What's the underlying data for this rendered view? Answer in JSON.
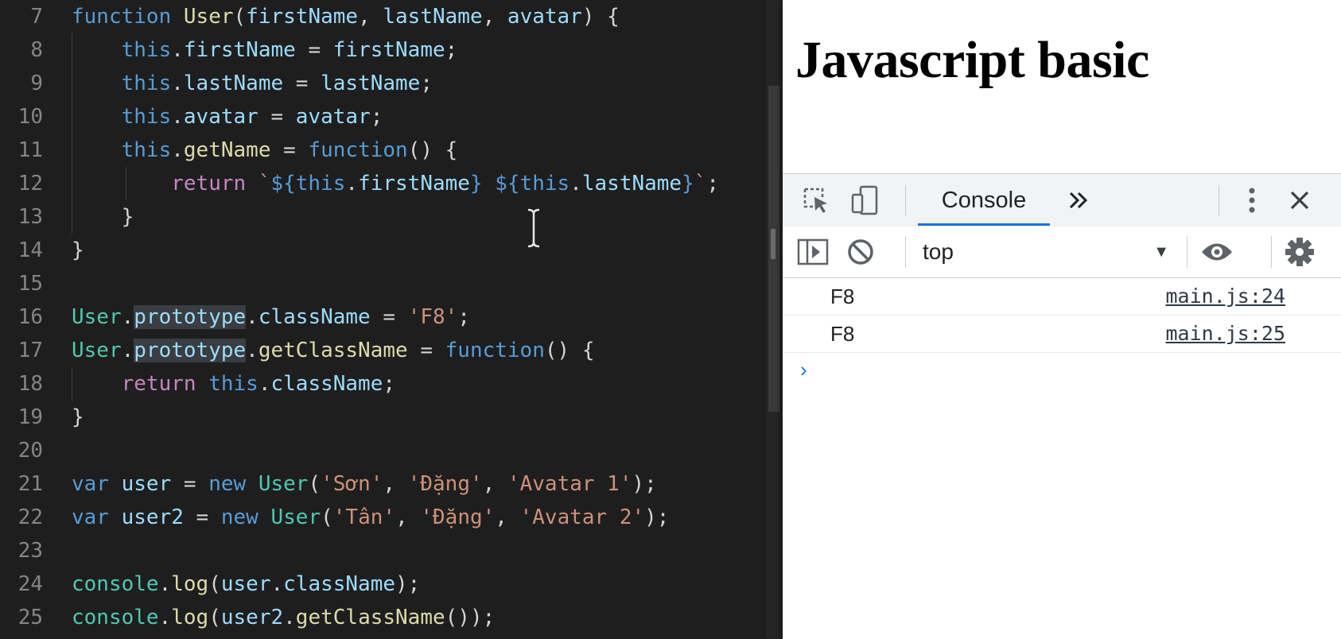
{
  "editor": {
    "lines": [
      {
        "num": "7",
        "tokens": [
          [
            "k-fn",
            "function"
          ],
          [
            "",
            ""
          ],
          [
            "t-fun",
            " User"
          ],
          [
            "",
            "("
          ],
          [
            "t-var",
            "firstName"
          ],
          [
            "",
            ", "
          ],
          [
            "t-var",
            "lastName"
          ],
          [
            "",
            ", "
          ],
          [
            "t-var",
            "avatar"
          ],
          [
            "",
            ") {"
          ]
        ]
      },
      {
        "num": "8",
        "tokens": [
          [
            "",
            "    "
          ],
          [
            "k-fn",
            "this"
          ],
          [
            "",
            "."
          ],
          [
            "t-var",
            "firstName"
          ],
          [
            "",
            " = "
          ],
          [
            "t-var",
            "firstName"
          ],
          [
            "",
            ";"
          ]
        ]
      },
      {
        "num": "9",
        "tokens": [
          [
            "",
            "    "
          ],
          [
            "k-fn",
            "this"
          ],
          [
            "",
            "."
          ],
          [
            "t-var",
            "lastName"
          ],
          [
            "",
            " = "
          ],
          [
            "t-var",
            "lastName"
          ],
          [
            "",
            ";"
          ]
        ]
      },
      {
        "num": "10",
        "tokens": [
          [
            "",
            "    "
          ],
          [
            "k-fn",
            "this"
          ],
          [
            "",
            "."
          ],
          [
            "t-var",
            "avatar"
          ],
          [
            "",
            " = "
          ],
          [
            "t-var",
            "avatar"
          ],
          [
            "",
            ";"
          ]
        ]
      },
      {
        "num": "11",
        "tokens": [
          [
            "",
            "    "
          ],
          [
            "k-fn",
            "this"
          ],
          [
            "",
            "."
          ],
          [
            "t-fun",
            "getName"
          ],
          [
            "",
            " = "
          ],
          [
            "k-fn",
            "function"
          ],
          [
            "",
            "() {"
          ]
        ]
      },
      {
        "num": "12",
        "tokens": [
          [
            "",
            "        "
          ],
          [
            "k-ctrl",
            "return"
          ],
          [
            "",
            " "
          ],
          [
            "t-str",
            "`"
          ],
          [
            "k-fn",
            "${"
          ],
          [
            "k-fn",
            "this"
          ],
          [
            "",
            "."
          ],
          [
            "t-var",
            "firstName"
          ],
          [
            "k-fn",
            "}"
          ],
          [
            "t-str",
            " "
          ],
          [
            "k-fn",
            "${"
          ],
          [
            "k-fn",
            "this"
          ],
          [
            "",
            "."
          ],
          [
            "t-var",
            "lastName"
          ],
          [
            "k-fn",
            "}"
          ],
          [
            "t-str",
            "`"
          ],
          [
            "",
            ";"
          ]
        ]
      },
      {
        "num": "13",
        "tokens": [
          [
            "",
            "    }"
          ]
        ]
      },
      {
        "num": "14",
        "tokens": [
          [
            "",
            "}"
          ]
        ]
      },
      {
        "num": "15",
        "tokens": []
      },
      {
        "num": "16",
        "tokens": [
          [
            "t-cls",
            "User"
          ],
          [
            "",
            "."
          ],
          [
            "t-var hl",
            "prototype"
          ],
          [
            "",
            "."
          ],
          [
            "t-var",
            "className"
          ],
          [
            "",
            " = "
          ],
          [
            "t-str",
            "'F8'"
          ],
          [
            "",
            ";"
          ]
        ]
      },
      {
        "num": "17",
        "tokens": [
          [
            "t-cls",
            "User"
          ],
          [
            "",
            "."
          ],
          [
            "t-var hl",
            "prototype"
          ],
          [
            "",
            "."
          ],
          [
            "t-fun",
            "getClassName"
          ],
          [
            "",
            " = "
          ],
          [
            "k-fn",
            "function"
          ],
          [
            "",
            "() {"
          ]
        ]
      },
      {
        "num": "18",
        "tokens": [
          [
            "",
            "    "
          ],
          [
            "k-ctrl",
            "return"
          ],
          [
            "",
            " "
          ],
          [
            "k-fn",
            "this"
          ],
          [
            "",
            "."
          ],
          [
            "t-var",
            "className"
          ],
          [
            "",
            ";"
          ]
        ]
      },
      {
        "num": "19",
        "tokens": [
          [
            "",
            "}"
          ]
        ]
      },
      {
        "num": "20",
        "tokens": []
      },
      {
        "num": "21",
        "tokens": [
          [
            "k-fn",
            "var"
          ],
          [
            "",
            " "
          ],
          [
            "t-var",
            "user"
          ],
          [
            "",
            " = "
          ],
          [
            "k-fn",
            "new"
          ],
          [
            "",
            " "
          ],
          [
            "t-cls",
            "User"
          ],
          [
            "",
            "("
          ],
          [
            "t-str",
            "'Sơn'"
          ],
          [
            "",
            ", "
          ],
          [
            "t-str",
            "'Đặng'"
          ],
          [
            "",
            ", "
          ],
          [
            "t-str",
            "'Avatar 1'"
          ],
          [
            "",
            ");"
          ]
        ]
      },
      {
        "num": "22",
        "tokens": [
          [
            "k-fn",
            "var"
          ],
          [
            "",
            " "
          ],
          [
            "t-var",
            "user2"
          ],
          [
            "",
            " = "
          ],
          [
            "k-fn",
            "new"
          ],
          [
            "",
            " "
          ],
          [
            "t-cls",
            "User"
          ],
          [
            "",
            "("
          ],
          [
            "t-str",
            "'Tân'"
          ],
          [
            "",
            ", "
          ],
          [
            "t-str",
            "'Đặng'"
          ],
          [
            "",
            ", "
          ],
          [
            "t-str",
            "'Avatar 2'"
          ],
          [
            "",
            ");"
          ]
        ]
      },
      {
        "num": "23",
        "tokens": []
      },
      {
        "num": "24",
        "tokens": [
          [
            "t-cls",
            "console"
          ],
          [
            "",
            "."
          ],
          [
            "t-fun",
            "log"
          ],
          [
            "",
            "("
          ],
          [
            "t-var",
            "user"
          ],
          [
            "",
            "."
          ],
          [
            "t-var",
            "className"
          ],
          [
            "",
            ");"
          ]
        ]
      },
      {
        "num": "25",
        "tokens": [
          [
            "t-cls",
            "console"
          ],
          [
            "",
            "."
          ],
          [
            "t-fun",
            "log"
          ],
          [
            "",
            "("
          ],
          [
            "t-var",
            "user2"
          ],
          [
            "",
            "."
          ],
          [
            "t-fun",
            "getClassName"
          ],
          [
            "",
            "());"
          ]
        ]
      }
    ]
  },
  "page": {
    "heading": "Javascript basic"
  },
  "devtools": {
    "tab_label": "Console",
    "more_tabs_icon": "double-chevron-right-icon",
    "context": "top",
    "logs": [
      {
        "message": "F8",
        "source": "main.js:24"
      },
      {
        "message": "F8",
        "source": "main.js:25"
      }
    ],
    "prompt": "›",
    "colors": {
      "accent": "#1a73e8",
      "editor_bg": "#1e1e1e"
    }
  }
}
